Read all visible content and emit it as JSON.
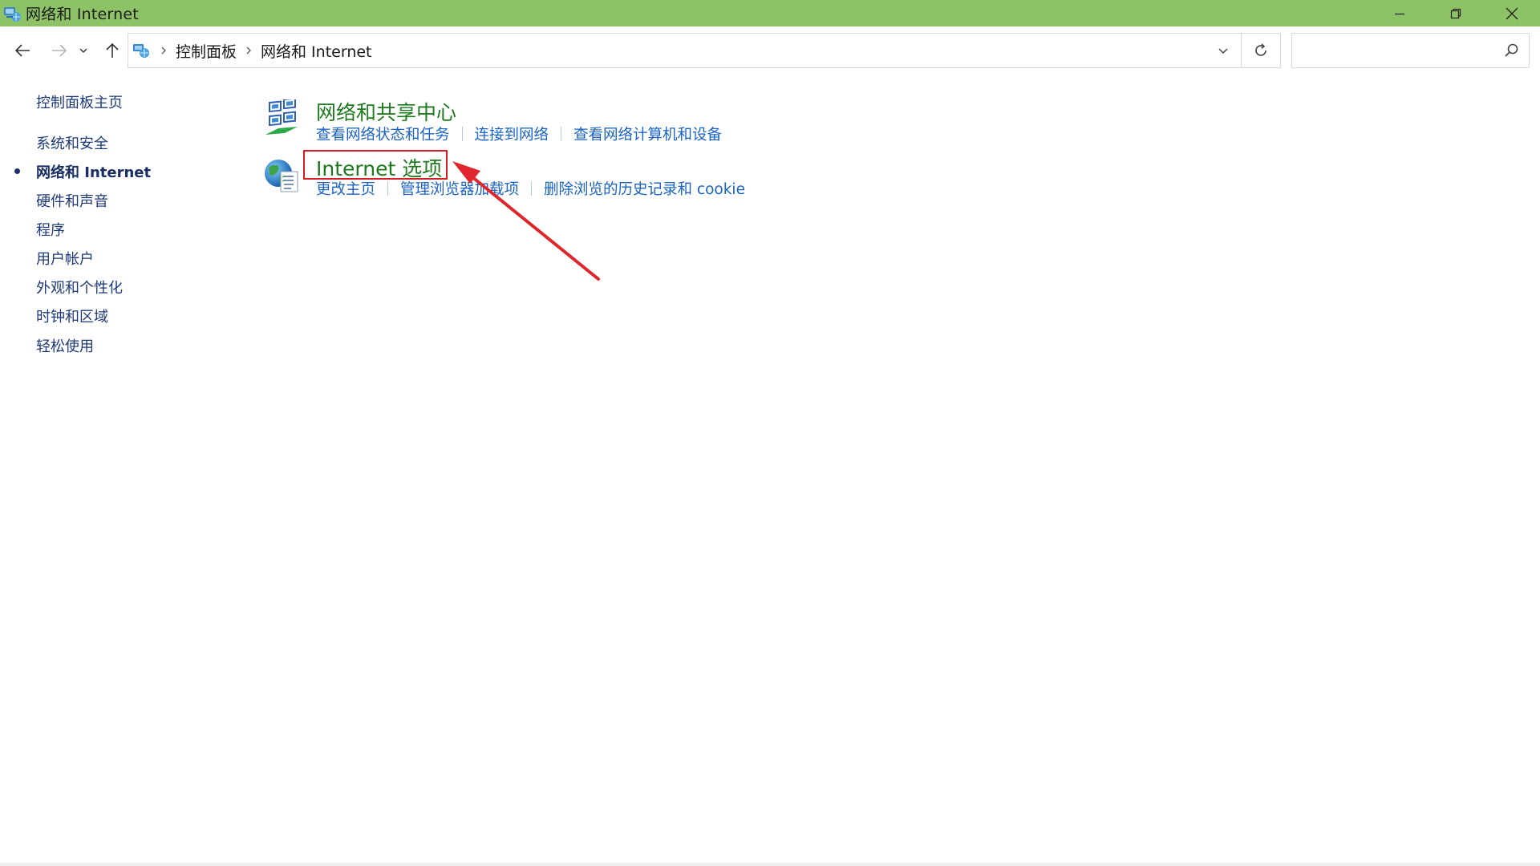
{
  "window": {
    "title": "网络和 Internet"
  },
  "address": {
    "breadcrumbs": [
      "控制面板",
      "网络和 Internet"
    ],
    "search_value": ""
  },
  "sidebar": {
    "home": "控制面板主页",
    "items": [
      {
        "label": "系统和安全"
      },
      {
        "label": "网络和 Internet",
        "current": true
      },
      {
        "label": "硬件和声音"
      },
      {
        "label": "程序"
      },
      {
        "label": "用户帐户"
      },
      {
        "label": "外观和个性化"
      },
      {
        "label": "时钟和区域"
      },
      {
        "label": "轻松使用"
      }
    ]
  },
  "categories": [
    {
      "title": "网络和共享中心",
      "icon": "network-sharing-center-icon",
      "links": [
        "查看网络状态和任务",
        "连接到网络",
        "查看网络计算机和设备"
      ]
    },
    {
      "title": "Internet 选项",
      "icon": "internet-options-icon",
      "links": [
        "更改主页",
        "管理浏览器加载项",
        "删除浏览的历史记录和 cookie"
      ]
    }
  ],
  "annotation": {
    "highlight_color": "#d21d24"
  },
  "colors": {
    "titlebar": "#8ec266",
    "category_title": "#1d7a1d",
    "link": "#1a63c7",
    "nav_text": "#1e3a78"
  }
}
